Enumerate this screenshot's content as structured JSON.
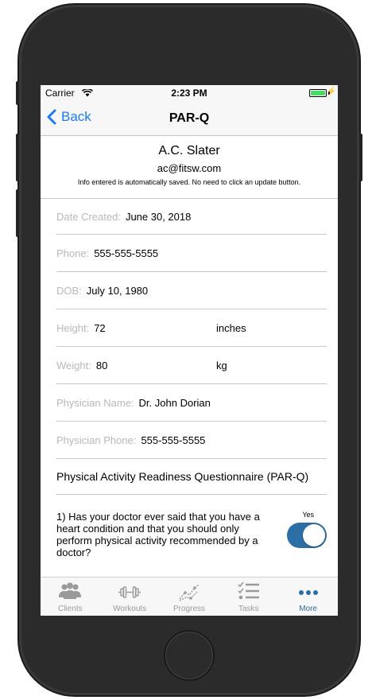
{
  "status_bar": {
    "carrier": "Carrier",
    "time": "2:23 PM"
  },
  "nav": {
    "back_label": "Back",
    "title": "PAR-Q"
  },
  "client": {
    "name": "A.C. Slater",
    "email": "ac@fitsw.com",
    "note": "Info entered is automatically saved. No need to click an update button."
  },
  "fields": {
    "date_created": {
      "label": "Date Created:",
      "value": "June 30, 2018"
    },
    "phone": {
      "label": "Phone:",
      "value": "555-555-5555"
    },
    "dob": {
      "label": "DOB:",
      "value": "July 10, 1980"
    },
    "height": {
      "label": "Height:",
      "value": "72",
      "unit": "inches"
    },
    "weight": {
      "label": "Weight:",
      "value": "80",
      "unit": "kg"
    },
    "physician_name": {
      "label": "Physician Name:",
      "value": "Dr. John Dorian"
    },
    "physician_phone": {
      "label": "Physician Phone:",
      "value": "555-555-5555"
    }
  },
  "questionnaire": {
    "title": "Physical Activity Readiness Questionnaire (PAR-Q)",
    "questions": [
      {
        "text": "1) Has your doctor ever said that you have a heart condition and that you should only perform physical activity recommended by a doctor?",
        "answer_label": "Yes",
        "answer_on": true
      }
    ]
  },
  "tabs": [
    {
      "label": "Clients",
      "icon": "clients-icon",
      "active": false
    },
    {
      "label": "Workouts",
      "icon": "dumbbell-icon",
      "active": false
    },
    {
      "label": "Progress",
      "icon": "progress-chart-icon",
      "active": false
    },
    {
      "label": "Tasks",
      "icon": "checklist-icon",
      "active": false
    },
    {
      "label": "More",
      "icon": "more-dots-icon",
      "active": true
    }
  ],
  "colors": {
    "accent_blue": "#1a7cf5",
    "toggle_on": "#2c6ea6",
    "active_tab": "#2c6ea6",
    "inactive_tab": "#9a9a9a",
    "battery_green": "#4cd964"
  }
}
